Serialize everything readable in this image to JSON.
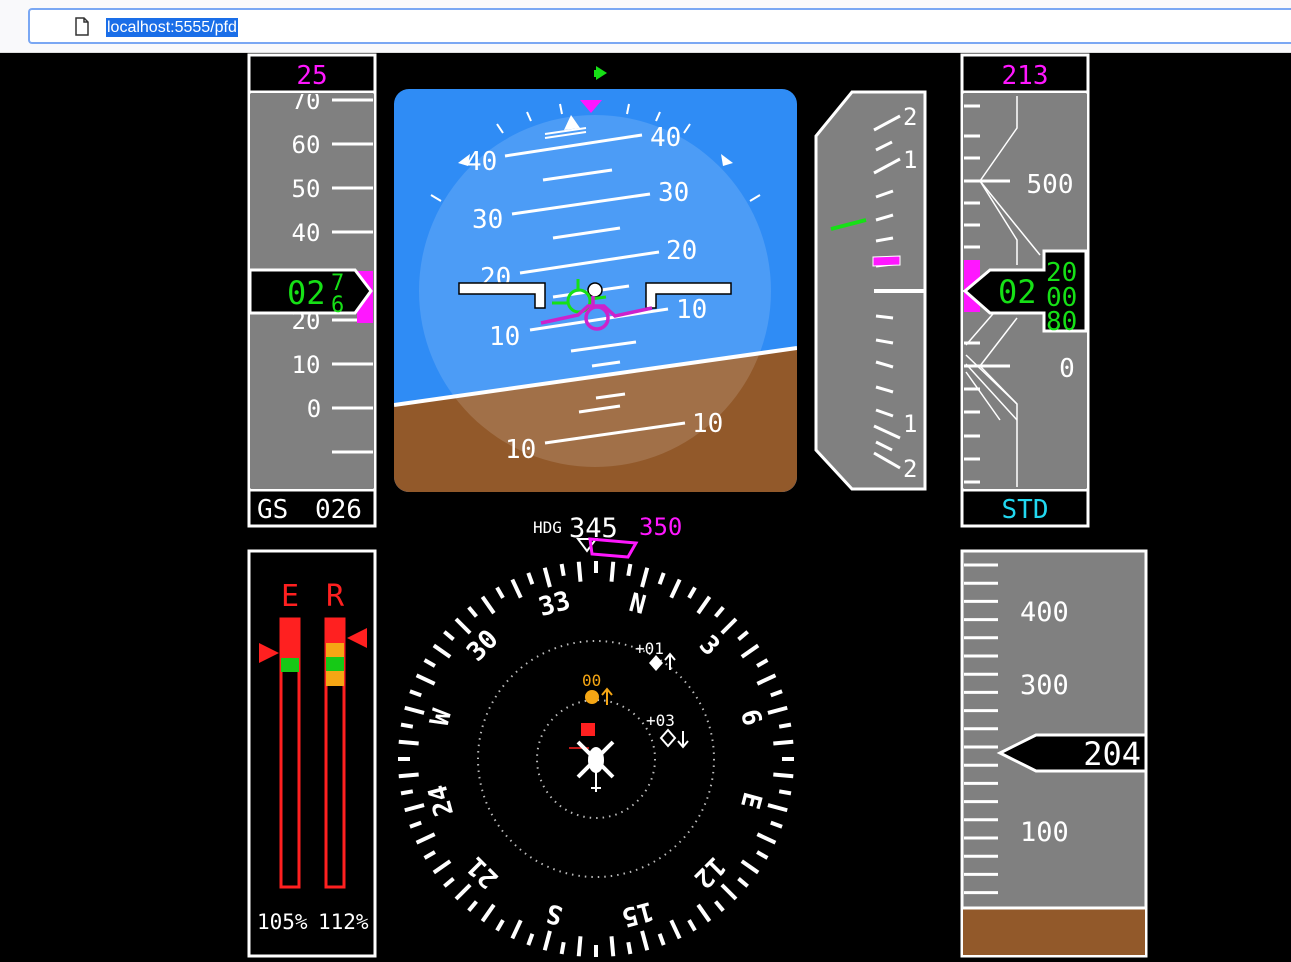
{
  "browser": {
    "url": "localhost:5555/pfd"
  },
  "speed": {
    "target": "25",
    "scale_labels": [
      "70",
      "60",
      "50",
      "40",
      "20",
      "10",
      "0"
    ],
    "current": "02",
    "roll_digits": [
      "7",
      "6"
    ],
    "ground_speed_label": "GS",
    "ground_speed": "026"
  },
  "attitude": {
    "pitch_labels": [
      "40",
      "40",
      "30",
      "30",
      "20",
      "20",
      "10",
      "10",
      "10",
      "10"
    ]
  },
  "vsi": {
    "labels": [
      "2",
      "1",
      "1",
      "2"
    ]
  },
  "altitude": {
    "selected": "213",
    "scale_labels": [
      "500",
      "0"
    ],
    "current_prefix": "02",
    "roll_digits": [
      "20",
      "00",
      "80"
    ],
    "baro_setting": "STD"
  },
  "engine": {
    "label_left": "E",
    "label_right": "R",
    "pct_left": "105%",
    "pct_right": "112%",
    "colors": {
      "red": "#ff2020",
      "green": "#16c916",
      "amber": "#f5a614"
    }
  },
  "heading": {
    "label": "HDG",
    "current": "345",
    "selected": "350",
    "rose_labels": [
      "N",
      "3",
      "6",
      "E",
      "12",
      "15",
      "S",
      "21",
      "24",
      "W",
      "30",
      "33"
    ],
    "traffic": [
      {
        "offset": "+01",
        "icon": "diamond-filled-icon"
      },
      {
        "offset": "00",
        "icon": "circle-amber-icon"
      },
      {
        "offset": "+03",
        "icon": "diamond-outline-icon"
      }
    ]
  },
  "radar_altitude": {
    "scale_labels": [
      "400",
      "300",
      "100"
    ],
    "current": "204"
  }
}
